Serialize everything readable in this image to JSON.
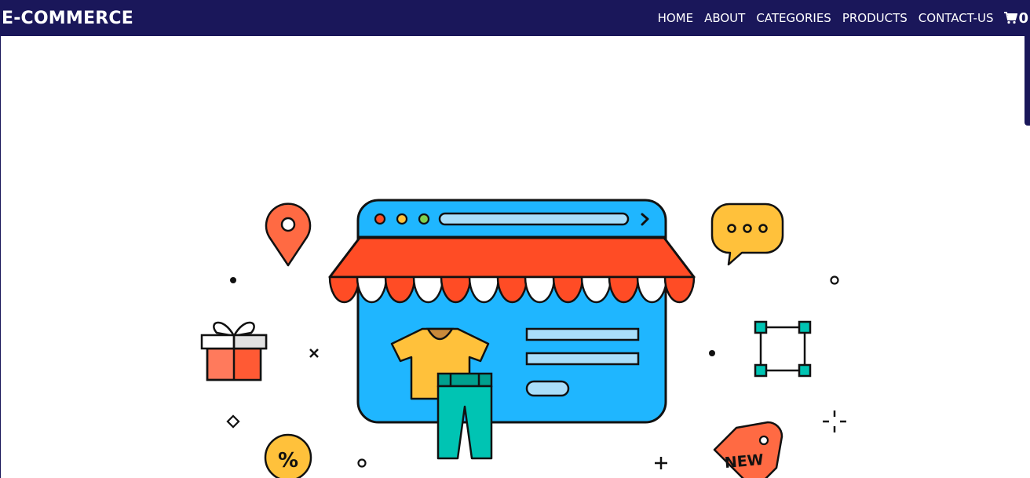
{
  "navbar": {
    "brand": "E-COMMERCE",
    "links": [
      "HOME",
      "ABOUT",
      "CATEGORIES",
      "PRODUCTS",
      "CONTACT-US"
    ],
    "cart_count": "0",
    "cart_icon": "shopping-cart-icon"
  },
  "hero": {
    "tag_text": "NEW",
    "discount_text": "%"
  },
  "colors": {
    "navbar_bg": "#1a175a",
    "store_blue": "#1fb6ff",
    "awning_red": "#ff4c25",
    "yellow": "#ffc13b",
    "teal": "#00c4b3",
    "coral": "#ff6a43"
  }
}
